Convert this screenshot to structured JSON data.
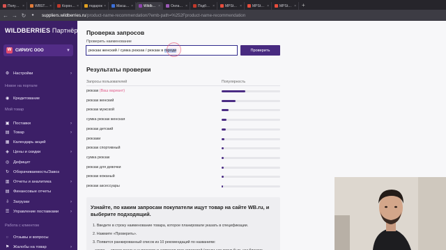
{
  "browser": {
    "tabs": [
      {
        "label": "Получить с...",
        "color": "#d9534f",
        "active": false
      },
      {
        "label": "WBSTAT.PR",
        "color": "#e07b39",
        "active": false
      },
      {
        "label": "Коронавир...",
        "color": "#c0392b",
        "active": false
      },
      {
        "label": "подарок",
        "color": "#e0a020",
        "active": false
      },
      {
        "label": "Масштабн...",
        "color": "#3b6fd8",
        "active": false
      },
      {
        "label": "Wildberrie...",
        "color": "#8e44ad",
        "active": true
      },
      {
        "label": "Онлайн ре...",
        "color": "#9b59b6",
        "active": false
      },
      {
        "label": "Подбор сл...",
        "color": "#c0392b",
        "active": false
      },
      {
        "label": "MPStats.io",
        "color": "#e74c3c",
        "active": false
      },
      {
        "label": "MPStats.io",
        "color": "#e74c3c",
        "active": false
      },
      {
        "label": "MPStats.io",
        "color": "#e74c3c",
        "active": false
      }
    ],
    "url_host": "suppliers.wildberries.ru",
    "url_path": "/product-name-recommendation/?emb-path=%252Fproduct-name-recommendation"
  },
  "sidebar": {
    "brand_main": "WILDBERRIES",
    "brand_sub": " Партнёры",
    "org_badge": "W",
    "org_name": "СИРИУС ООО",
    "items": [
      {
        "label": "Настройки",
        "icon": "gear-icon",
        "arrow": true
      },
      {
        "label": "Кредитование",
        "icon": "coin-icon",
        "arrow": false
      },
      {
        "label": "Поставки",
        "icon": "truck-icon",
        "arrow": true
      },
      {
        "label": "Товар",
        "icon": "box-icon",
        "arrow": true
      },
      {
        "label": "Календарь акций",
        "icon": "calendar-icon",
        "arrow": false
      },
      {
        "label": "Цены и скидки",
        "icon": "tag-icon",
        "arrow": true
      },
      {
        "label": "Дефицит",
        "icon": "alert-icon",
        "arrow": false
      },
      {
        "label": "Оборачиваемость/Завоз",
        "icon": "refresh-icon",
        "arrow": false
      },
      {
        "label": "Отчеты и аналитика",
        "icon": "chart-icon",
        "arrow": true
      },
      {
        "label": "Финансовые отчеты",
        "icon": "report-icon",
        "arrow": false
      },
      {
        "label": "Загрузки",
        "icon": "download-icon",
        "arrow": true
      },
      {
        "label": "Управление поставками",
        "icon": "list-icon",
        "arrow": true
      },
      {
        "label": "Отзывы и вопросы",
        "icon": "chat-icon",
        "arrow": false
      },
      {
        "label": "Жалобы на товар",
        "icon": "flag-icon",
        "arrow": true
      }
    ],
    "section_new": "Новое на портале",
    "section_goods": "Мой товар",
    "section_clients": "Работа с клиентом"
  },
  "main": {
    "title": "Проверка запросов",
    "input_label": "Проверить наименование",
    "input_value_before": "рюкзак женский / сумка рюкзак / рюкзак в ",
    "input_value_selected": "городе",
    "check_button": "Проверить",
    "results_title": "Результаты проверки",
    "col_queries": "Запросы пользователей",
    "col_popularity": "Популярность",
    "rows": [
      {
        "query": "рюкзак",
        "hint": " (Ваш вариант)",
        "popularity": 0.4
      },
      {
        "query": "рюкзак женский",
        "hint": "",
        "popularity": 0.24
      },
      {
        "query": "рюкзак мужской",
        "hint": "",
        "popularity": 0.12
      },
      {
        "query": "сумка рюкзак женская",
        "hint": "",
        "popularity": 0.08
      },
      {
        "query": "рюкзак детский",
        "hint": "",
        "popularity": 0.07
      },
      {
        "query": "рюкзаки",
        "hint": "",
        "popularity": 0.05
      },
      {
        "query": "рюкзак спортивный",
        "hint": "",
        "popularity": 0.04
      },
      {
        "query": "сумка рюкзак",
        "hint": "",
        "popularity": 0.03
      },
      {
        "query": "рюкзак для девочки",
        "hint": "",
        "popularity": 0.03
      },
      {
        "query": "рюкзак кожаный",
        "hint": "",
        "popularity": 0.03
      },
      {
        "query": "рюкзак аксессуары",
        "hint": "",
        "popularity": 0.02
      }
    ],
    "info_title": "Узнайте, по каким запросам покупатели ищут товар на сайте WB.ru, и выберите подходящий.",
    "info_steps": [
      "1. Введите в строку наименование товара, которое планировали указать в спецификации.",
      "2. Нажмите «Проверить».",
      "3. Появится ранжированный список из 10 рекомендаций по названиям:",
      "- слева — список реальных поисковых запросов пользователей (среди них могут быть как близкие"
    ]
  },
  "colors": {
    "sidebar_bg": "#3c1f67",
    "accent": "#482a80",
    "bar": "#4b2c84",
    "hint": "#e05a88"
  }
}
